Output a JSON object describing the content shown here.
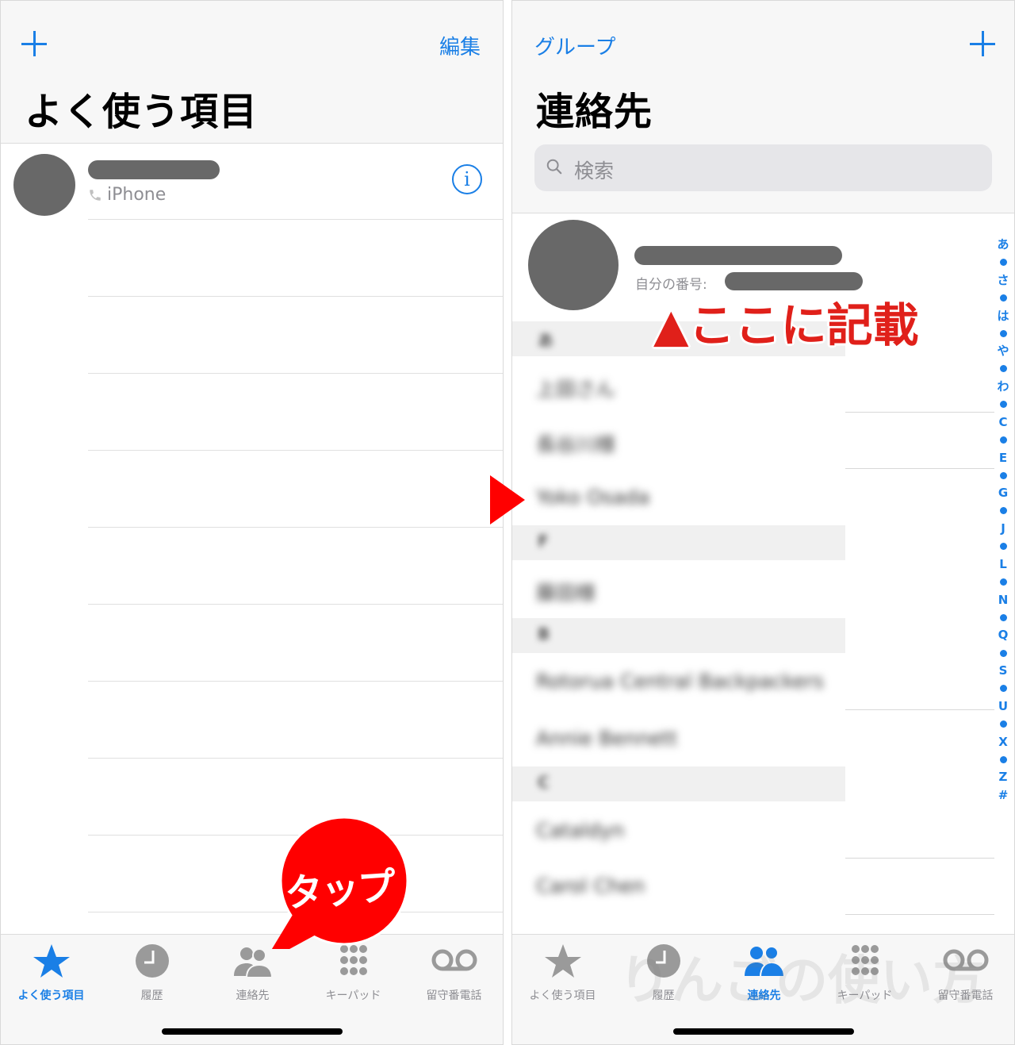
{
  "colors": {
    "accent": "#1a7fe6",
    "inactive": "#8e8e93",
    "annotation_red": "#e0201a",
    "callout_red": "#ff0000",
    "redaction": "#686868"
  },
  "left_screen": {
    "nav": {
      "add_icon": "plus-icon",
      "edit_label": "編集"
    },
    "title": "よく使う項目",
    "favorites": [
      {
        "name": "[redacted]",
        "subtitle": "iPhone",
        "subtitle_icon": "phone-icon",
        "accessory_icon": "info-icon",
        "accessory_label": "i"
      }
    ],
    "empty_row_count": 9
  },
  "right_screen": {
    "nav": {
      "groups_label": "グループ",
      "add_icon": "plus-icon"
    },
    "title": "連絡先",
    "search": {
      "placeholder": "検索",
      "icon": "search-icon"
    },
    "my_card": {
      "name": "[redacted]",
      "number_label": "自分の番号:",
      "number": "[redacted]"
    },
    "sections": [
      {
        "letter": "あ",
        "contacts": [
          "上田さん",
          "長谷川様",
          "Yoko Osada"
        ]
      },
      {
        "letter": "F",
        "contacts": [
          "藤田様"
        ]
      },
      {
        "letter": "B",
        "contacts": [
          "Rotorua Central Backpackers",
          "Annie Bennett"
        ]
      },
      {
        "letter": "C",
        "contacts": [
          "Cataldyn",
          "Carol Chen"
        ]
      }
    ],
    "index": [
      "あ",
      "•",
      "さ",
      "•",
      "は",
      "•",
      "や",
      "•",
      "わ",
      "•",
      "C",
      "•",
      "E",
      "•",
      "G",
      "•",
      "J",
      "•",
      "L",
      "•",
      "N",
      "•",
      "Q",
      "•",
      "S",
      "•",
      "U",
      "•",
      "X",
      "•",
      "Z",
      "#"
    ]
  },
  "tabbar": {
    "tabs": [
      {
        "label": "よく使う項目",
        "icon": "star-icon"
      },
      {
        "label": "履歴",
        "icon": "clock-icon"
      },
      {
        "label": "連絡先",
        "icon": "contacts-icon"
      },
      {
        "label": "キーパッド",
        "icon": "keypad-icon"
      },
      {
        "label": "留守番電話",
        "icon": "voicemail-icon"
      }
    ],
    "left_active_index": 0,
    "right_active_index": 2
  },
  "annotations": {
    "tap_callout": "タップ",
    "note": "▲ここに記載",
    "transition_arrow": "arrow-right"
  },
  "watermark": "りんごの使い方"
}
